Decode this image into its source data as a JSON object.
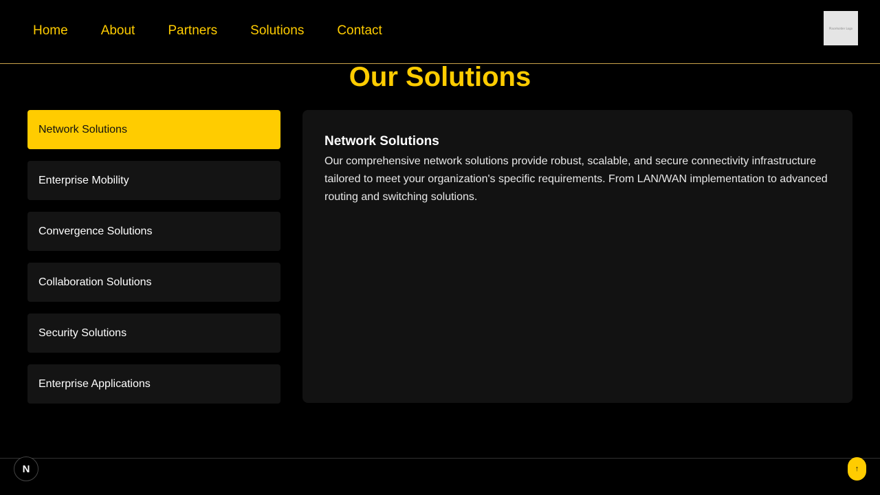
{
  "nav": {
    "links": [
      "Home",
      "About",
      "Partners",
      "Solutions",
      "Contact"
    ],
    "logo_text": "Placeholder Logo",
    "accent_color": "#ffcc00"
  },
  "page_title": "Our Solutions",
  "sidebar": {
    "items": [
      {
        "label": "Network Solutions",
        "active": true
      },
      {
        "label": "Enterprise Mobility",
        "active": false
      },
      {
        "label": "Convergence Solutions",
        "active": false
      },
      {
        "label": "Collaboration Solutions",
        "active": false
      },
      {
        "label": "Security Solutions",
        "active": false
      },
      {
        "label": "Enterprise Applications",
        "active": false
      }
    ]
  },
  "content": {
    "title": "Network Solutions",
    "body": "Our comprehensive network solutions provide robust, scalable, and secure connectivity infrastructure tailored to meet your organization's specific requirements. From LAN/WAN implementation to advanced routing and switching solutions."
  },
  "footer": {
    "badge_letter": "N",
    "badge_icon": "nextjs-icon",
    "scroll_top_glyph": "↑",
    "scroll_top_icon": "arrow-up-icon"
  }
}
